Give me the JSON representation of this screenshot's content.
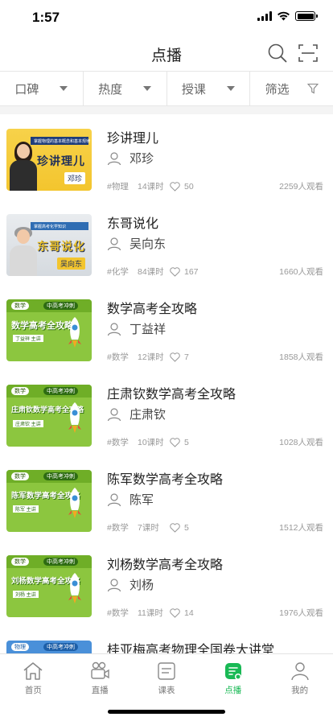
{
  "status": {
    "time": "1:57"
  },
  "nav": {
    "title": "点播"
  },
  "filters": [
    {
      "label": "口碑"
    },
    {
      "label": "热度"
    },
    {
      "label": "授课"
    },
    {
      "label": "筛选"
    }
  ],
  "courses": [
    {
      "title": "珍讲理儿",
      "teacher": "邓珍",
      "tag": "#物理",
      "lessons": "14课时",
      "likes": "50",
      "views": "2259人观看",
      "thumb": {
        "style": "yellow",
        "subtitle": "掌握物理的基本概念和基本规律",
        "big": "珍讲理儿",
        "name": "邓珍"
      }
    },
    {
      "title": "东哥说化",
      "teacher": "吴向东",
      "tag": "#化学",
      "lessons": "84课时",
      "likes": "167",
      "views": "1660人观看",
      "thumb": {
        "style": "gray",
        "subtitle": "掌握高考化学知识",
        "big": "东哥说化",
        "name": "吴向东"
      }
    },
    {
      "title": "数学高考全攻略",
      "teacher": "丁益祥",
      "tag": "#数学",
      "lessons": "12课时",
      "likes": "7",
      "views": "1858人观看",
      "thumb": {
        "style": "green",
        "chip1": "数学",
        "chip2": "中高考冲刺",
        "big": "数学高考全攻略",
        "name": "丁益祥 主讲"
      }
    },
    {
      "title": "庄肃钦数学高考全攻略",
      "teacher": "庄肃钦",
      "tag": "#数学",
      "lessons": "10课时",
      "likes": "5",
      "views": "1028人观看",
      "thumb": {
        "style": "green",
        "chip1": "数学",
        "chip2": "中高考冲刺",
        "big": "庄肃钦数学高考全攻略",
        "name": "庄肃钦 主讲"
      }
    },
    {
      "title": "陈军数学高考全攻略",
      "teacher": "陈军",
      "tag": "#数学",
      "lessons": "7课时",
      "likes": "5",
      "views": "1512人观看",
      "thumb": {
        "style": "green",
        "chip1": "数学",
        "chip2": "中高考冲刺",
        "big": "陈军数学高考全攻略",
        "name": "陈军 主讲"
      }
    },
    {
      "title": "刘杨数学高考全攻略",
      "teacher": "刘杨",
      "tag": "#数学",
      "lessons": "11课时",
      "likes": "14",
      "views": "1976人观看",
      "thumb": {
        "style": "green",
        "chip1": "数学",
        "chip2": "中高考冲刺",
        "big": "刘杨数学高考全攻略",
        "name": "刘杨 主讲"
      }
    },
    {
      "title": "桂亚梅高考物理全国卷大讲堂",
      "teacher": "",
      "tag": "",
      "lessons": "",
      "likes": "",
      "views": "",
      "thumb": {
        "style": "blue",
        "chip1": "物理",
        "chip2": "中高考冲刺",
        "big": "",
        "name": ""
      }
    }
  ],
  "tabs": [
    {
      "label": "首页",
      "icon": "home-icon"
    },
    {
      "label": "直播",
      "icon": "camera-icon"
    },
    {
      "label": "课表",
      "icon": "schedule-icon"
    },
    {
      "label": "点播",
      "icon": "vod-icon",
      "active": true
    },
    {
      "label": "我的",
      "icon": "profile-icon"
    }
  ],
  "colors": {
    "accent": "#19b955",
    "thumb_green": "#8cc63f",
    "thumb_yellow": "#f3c52e"
  }
}
